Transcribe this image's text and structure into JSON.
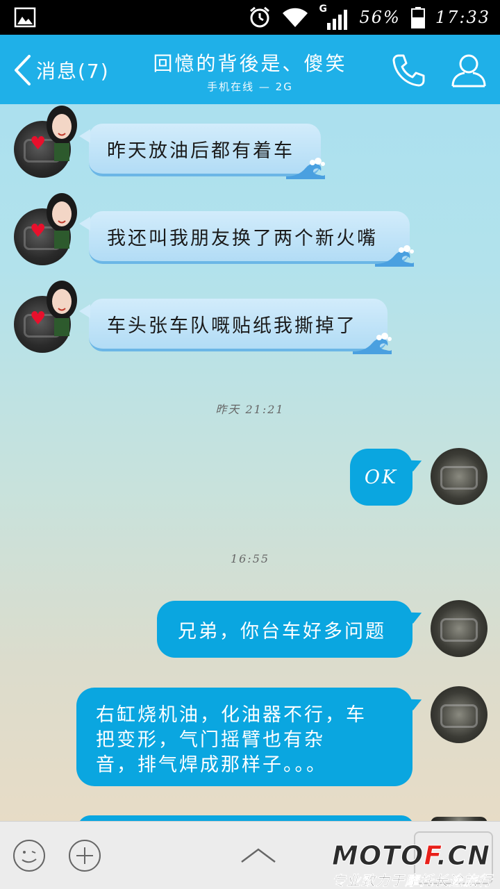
{
  "status_bar": {
    "network_label": "G",
    "battery": "56%",
    "time": "17:33"
  },
  "header": {
    "back_label": "消息(7)",
    "title": "回憶的背後是、傻笑",
    "subtitle": "手机在线 — 2G"
  },
  "messages": [
    {
      "direction": "in",
      "text": "昨天放油后都有着车"
    },
    {
      "direction": "in",
      "text": "我还叫我朋友换了两个新火嘴"
    },
    {
      "direction": "in",
      "text": "车头张车队嘅贴纸我撕掉了"
    },
    {
      "direction": "out",
      "text": "OK"
    },
    {
      "direction": "out",
      "text": "兄弟，你台车好多问题"
    },
    {
      "direction": "out",
      "lines": [
        "右缸烧机油，化油器不行，车",
        "把变形，气门摇臂也有杂",
        "音，排气焊成那样子。。。"
      ]
    }
  ],
  "timestamps": [
    "昨天 21:21",
    "16:55"
  ],
  "watermark": {
    "brand_prefix": "MOTO",
    "brand_accent": "F",
    "brand_suffix": ".CN",
    "tagline": "专业致力于摩托长途旅行"
  },
  "colors": {
    "header_bg": "#1fb0e8",
    "outgoing_bubble": "#0aa6e0",
    "incoming_bubble": "#c4e5f8",
    "brand_red": "#e8201a"
  },
  "icons": [
    "gallery-icon",
    "alarm-icon",
    "wifi-icon",
    "signal-icon",
    "battery-icon",
    "back-chevron-icon",
    "phone-icon",
    "profile-icon",
    "emoji-icon",
    "plus-icon",
    "chevron-up-icon"
  ]
}
